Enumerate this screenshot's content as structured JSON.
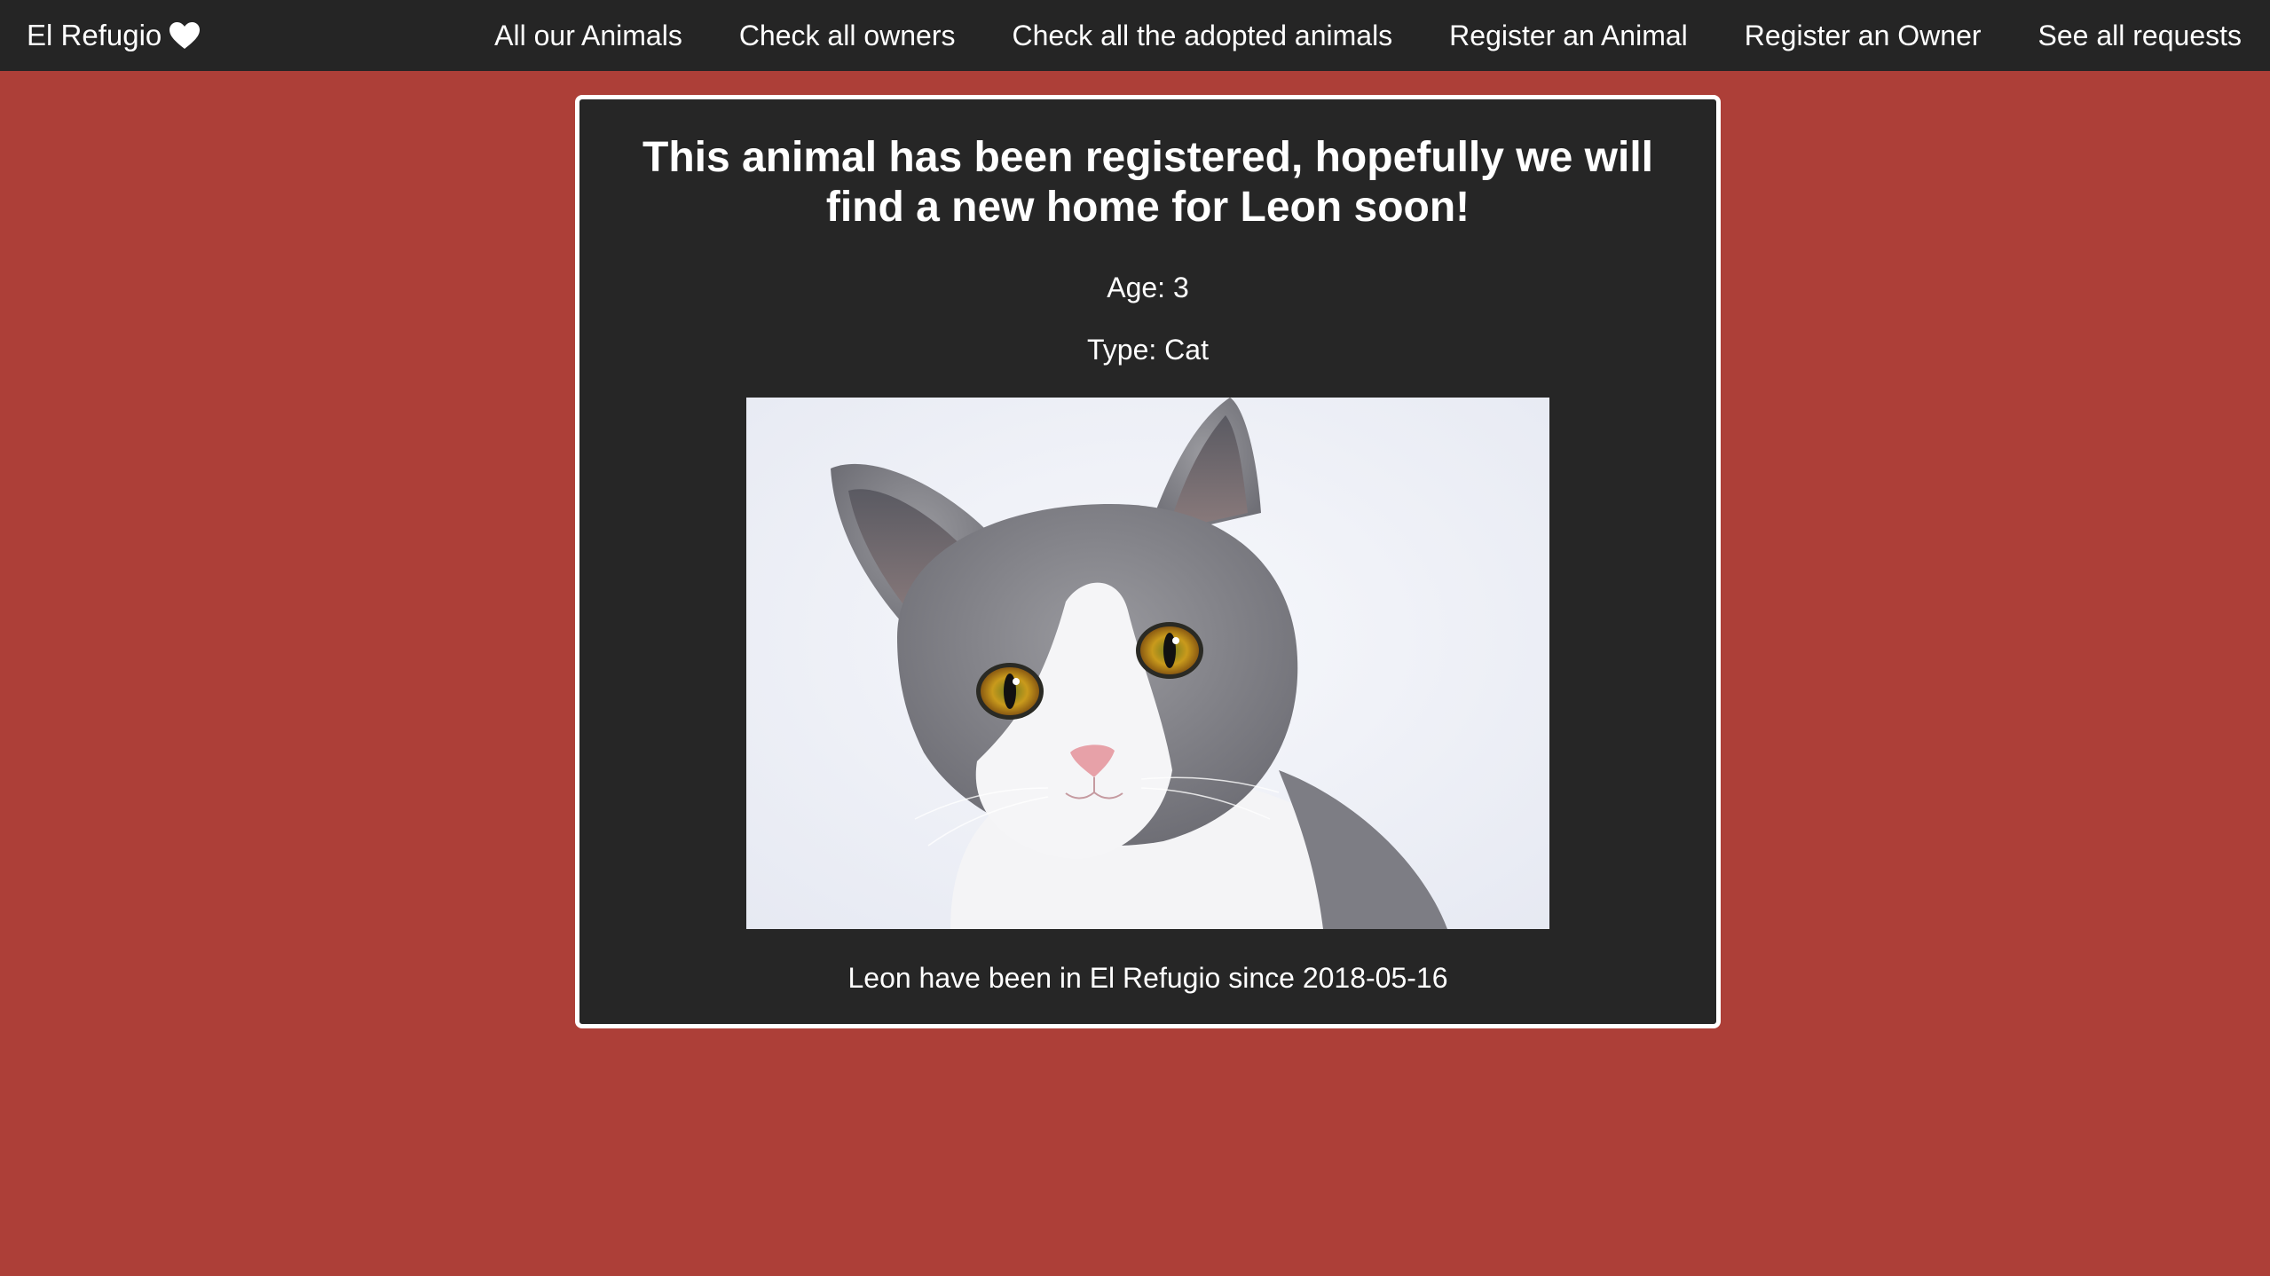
{
  "navbar": {
    "brand": "El Refugio",
    "brand_icon": "heart-icon",
    "links": [
      "All our Animals",
      "Check all owners",
      "Check all the adopted animals",
      "Register an Animal",
      "Register an Owner",
      "See all requests"
    ]
  },
  "card": {
    "title": "This animal has been registered, hopefully we will find a new home for Leon soon!",
    "age": "Age: 3",
    "type": "Type: Cat",
    "since": "Leon have been in El Refugio since 2018-05-16"
  },
  "colors": {
    "page_background": "#ad3f38",
    "navbar_background": "#252525",
    "card_background": "#262626",
    "card_border": "#ffffff",
    "text": "#ffffff"
  }
}
